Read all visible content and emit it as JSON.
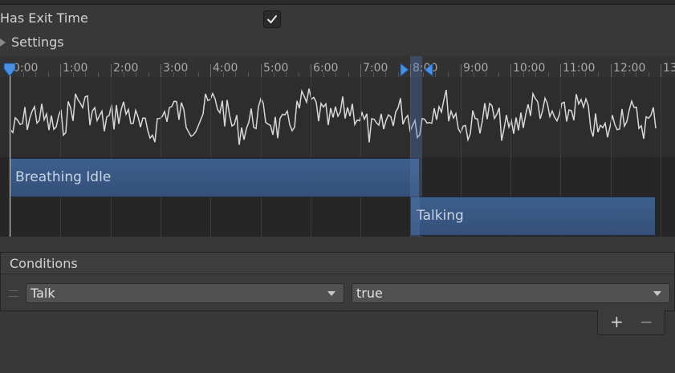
{
  "settings": {
    "has_exit_time_label": "Has Exit Time",
    "has_exit_time_checked": true,
    "settings_label": "Settings"
  },
  "timeline": {
    "ticks": [
      "0:00",
      "1:00",
      "2:00",
      "3:00",
      "4:00",
      "5:00",
      "6:00",
      "7:00",
      "8:00",
      "9:00",
      "10:00",
      "11:00",
      "12:00",
      "13:"
    ],
    "clips": {
      "source_name": "Breathing Idle",
      "destination_name": "Talking"
    }
  },
  "conditions": {
    "title": "Conditions",
    "items": [
      {
        "parameter": "Talk",
        "value": "true"
      }
    ],
    "add_label": "+",
    "remove_label": "−"
  },
  "colors": {
    "accent": "#3e5f8d",
    "marker": "#4a90e2",
    "background": "#383838"
  }
}
